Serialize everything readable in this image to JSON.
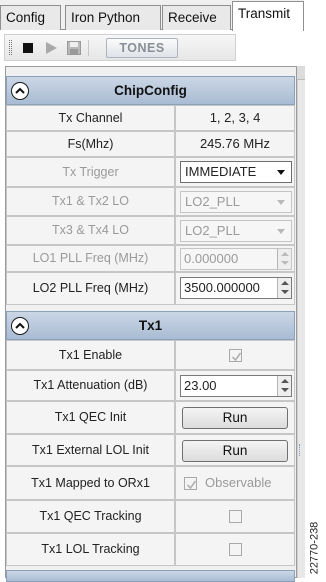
{
  "tabs": [
    "Config",
    "Iron Python",
    "Receive",
    "Transmit"
  ],
  "toolbar": {
    "tones_label": "TONES"
  },
  "chipconfig": {
    "title": "ChipConfig",
    "rows": [
      {
        "label": "Tx Channel",
        "value": "1, 2, 3, 4"
      },
      {
        "label": "Fs(Mhz)",
        "value": "245.76 MHz"
      },
      {
        "label": "Tx Trigger",
        "value": "IMMEDIATE"
      },
      {
        "label": "Tx1 & Tx2 LO",
        "value": "LO2_PLL"
      },
      {
        "label": "Tx3 & Tx4 LO",
        "value": "LO2_PLL"
      },
      {
        "label": "LO1 PLL Freq (MHz)",
        "value": "0.000000"
      },
      {
        "label": "LO2 PLL Freq (MHz)",
        "value": "3500.000000"
      }
    ]
  },
  "tx1": {
    "title": "Tx1",
    "rows": [
      {
        "label": "Tx1 Enable",
        "checked": true
      },
      {
        "label": "Tx1 Attenuation (dB)",
        "value": "23.00"
      },
      {
        "label": "Tx1 QEC Init",
        "button": "Run"
      },
      {
        "label": "Tx1 External LOL Init",
        "button": "Run"
      },
      {
        "label": "Tx1 Mapped to ORx1",
        "checked": true,
        "check_label": "Observable"
      },
      {
        "label": "Tx1 QEC Tracking",
        "checked": false
      },
      {
        "label": "Tx1 LOL Tracking",
        "checked": false
      }
    ]
  },
  "figure_id": "22770-238"
}
